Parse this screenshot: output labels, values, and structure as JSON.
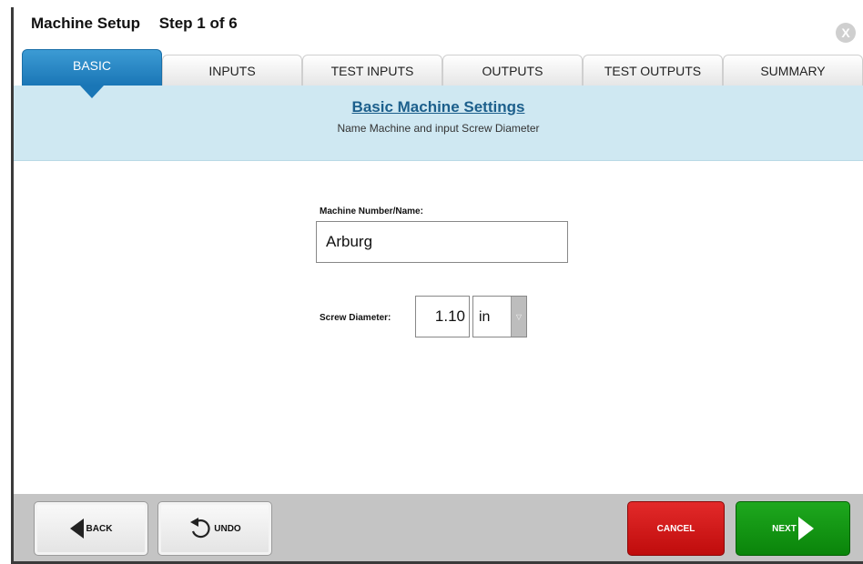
{
  "window": {
    "title": "Machine Setup",
    "step": "Step 1 of 6",
    "close_glyph": "X"
  },
  "tabs": [
    {
      "label": "BASIC",
      "active": true
    },
    {
      "label": "INPUTS",
      "active": false
    },
    {
      "label": "TEST INPUTS",
      "active": false
    },
    {
      "label": "OUTPUTS",
      "active": false
    },
    {
      "label": "TEST OUTPUTS",
      "active": false
    },
    {
      "label": "SUMMARY",
      "active": false
    }
  ],
  "banner": {
    "title": "Basic Machine Settings",
    "subtitle": "Name Machine and input Screw Diameter"
  },
  "form": {
    "machine_name_label": "Machine Number/Name:",
    "machine_name_value": "Arburg",
    "screw_diameter_label": "Screw Diameter:",
    "screw_diameter_value": "1.10",
    "unit_value": "in",
    "unit_arrow": "▽"
  },
  "footer": {
    "back_label": "BACK",
    "undo_label": "UNDO",
    "cancel_label": "CANCEL",
    "next_label": "NEXT"
  },
  "colors": {
    "tab_active": "#1a76b6",
    "banner_bg": "#cfe8f2",
    "cancel": "#d01818",
    "next": "#149614"
  }
}
